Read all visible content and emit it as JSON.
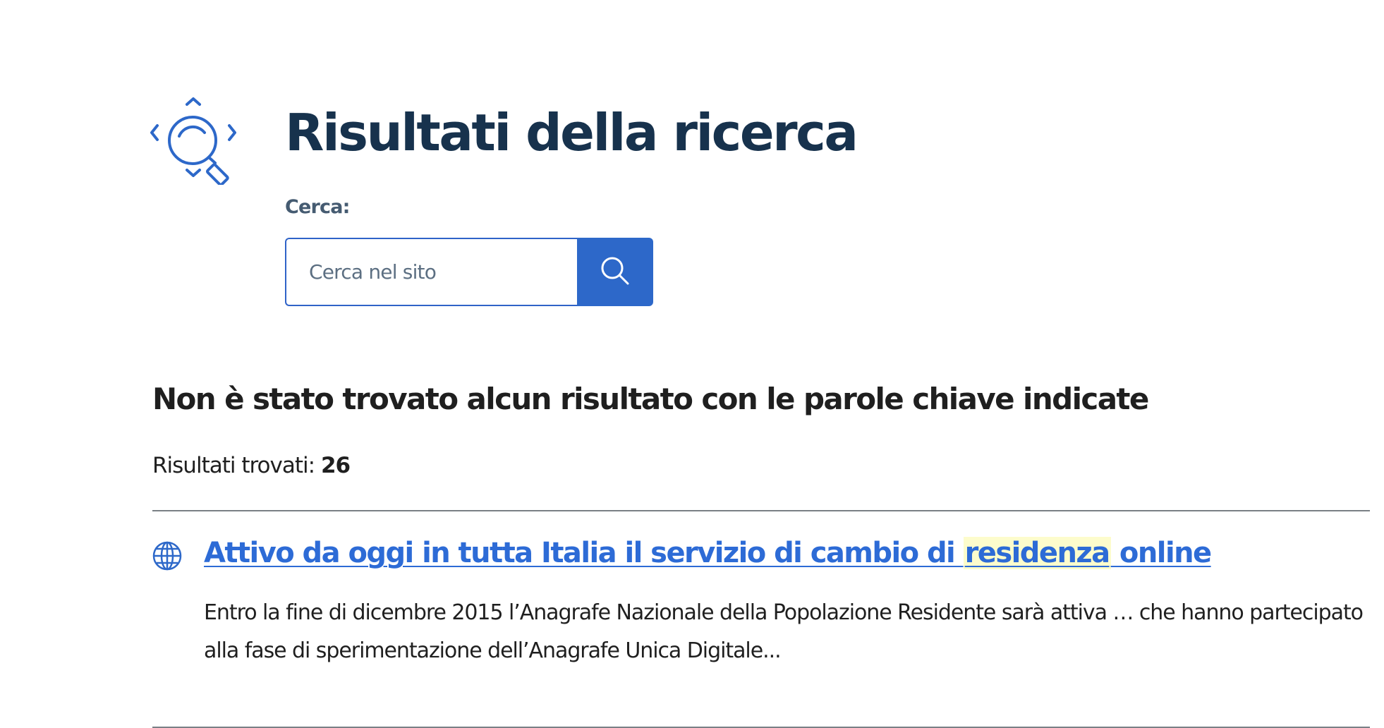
{
  "header": {
    "title": "Risultati della ricerca",
    "icon": "search-arrows-icon"
  },
  "search": {
    "label": "Cerca:",
    "placeholder": "Cerca nel sito",
    "value": "",
    "button_icon": "search-icon"
  },
  "results": {
    "no_results_message": "Non è stato trovato alcun risultato con le parole chiave indicate",
    "count_label": "Risultati trovati:",
    "count": "26",
    "items": [
      {
        "icon": "globe-icon",
        "title_before": "Attivo da oggi in tutta Italia il servizio di cambio di ",
        "title_highlight": "residenza",
        "title_after": " online",
        "excerpt": "Entro la fine di dicembre 2015 l’Anagrafe Nazionale della Popolazione Residente sarà attiva … che hanno partecipato alla fase di sperimentazione dell’Anagrafe Unica Digitale..."
      }
    ]
  },
  "colors": {
    "primary": "#2d68c9",
    "title": "#17324d",
    "link": "#2d6bd6",
    "highlight": "#fdfccc"
  }
}
